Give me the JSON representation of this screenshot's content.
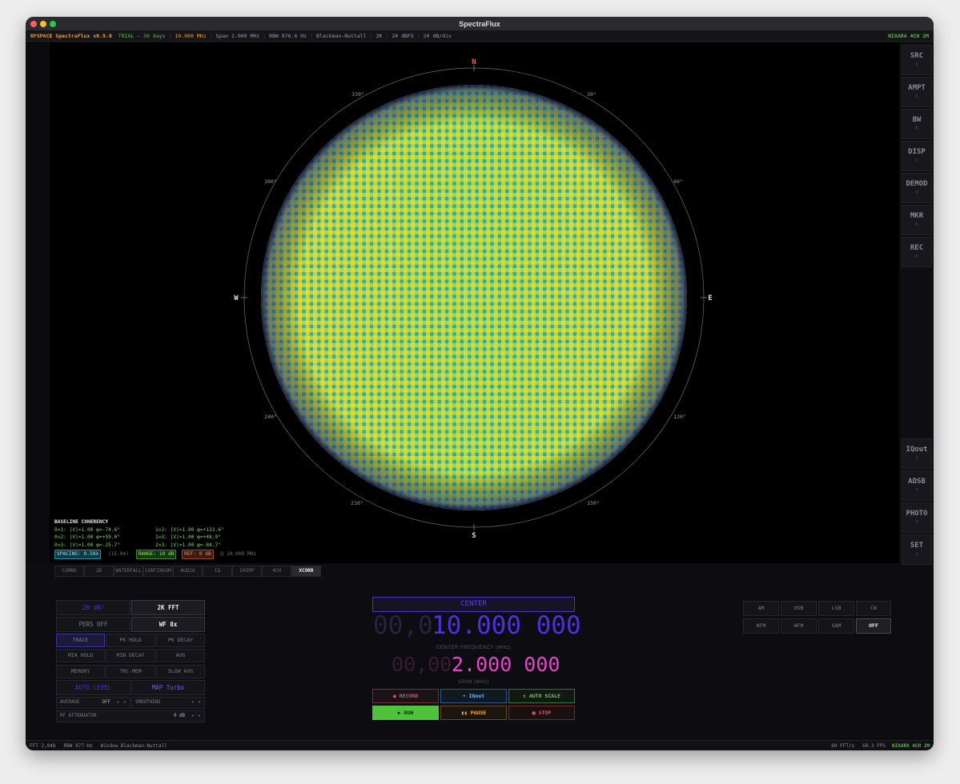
{
  "window": {
    "title": "SpectraFlux"
  },
  "status": {
    "brand": "RFSPACE SpectraFlux v0.9.0",
    "trial": "TRIAL — 30 days",
    "freq": "10.000 MHz",
    "span": "Span 2.000 MHz",
    "rbw": "RBW 976.6 Hz",
    "window": "Blackman-Nuttall",
    "fft": "2K",
    "ref": "20 dBFS",
    "scale": "20 dB/div",
    "device": "NIXARA 4CH 2M"
  },
  "compass": {
    "n": "N",
    "e": "E",
    "s": "S",
    "w": "W",
    "d30": "30°",
    "d60": "60°",
    "d120": "120°",
    "d150": "150°",
    "d210": "210°",
    "d240": "240°",
    "d300": "300°",
    "d330": "330°"
  },
  "coherency": {
    "title": "BASELINE COHERENCY",
    "rows": [
      "0×1: |V|=1.00  φ=-74.6°",
      "0×2: |V|=1.00  φ=+59.0°",
      "0×3: |V|=1.00  φ=-25.7°"
    ],
    "rows2": [
      "1×2: |V|=1.00  φ=+133.6°",
      "1×3: |V|=1.00  φ=+48.9°",
      "2×3: |V|=1.00  φ=-84.7°"
    ],
    "spacing": "SPACING: 0.50λ",
    "spacing_m": "(15.0m)",
    "range": "RANGE: 10 dB",
    "ref": "REF: 0 dB",
    "at": "@ 10.000 MHz"
  },
  "rightbar": [
    {
      "label": "SRC",
      "key": "S"
    },
    {
      "label": "AMPT",
      "key": "A"
    },
    {
      "label": "BW",
      "key": "B"
    },
    {
      "label": "DISP",
      "key": "D"
    },
    {
      "label": "DEMOD",
      "key": "M"
    },
    {
      "label": "MKR",
      "key": "K"
    },
    {
      "label": "REC",
      "key": "R"
    },
    {
      "label": "IQout",
      "key": "I"
    },
    {
      "label": "ADSB",
      "key": "T"
    },
    {
      "label": "PHOTO",
      "key": "P"
    },
    {
      "label": "SET",
      "key": "G"
    }
  ],
  "tabs": [
    "COMBO",
    "2D",
    "WATERFALL",
    "CONTINUUM",
    "AUDIO",
    "IQ",
    "CHIRP",
    "4CH",
    "XCORR"
  ],
  "left_controls": {
    "db_div": "20 dB/",
    "fft": "2K FFT",
    "pers": "PERS OFF",
    "wf": "WF 8x",
    "trace": "TRACE",
    "pk_hold": "PK HOLD",
    "pk_decay": "PK DECAY",
    "min_hold": "MIN HOLD",
    "min_decay": "MIN DECAY",
    "avg": "AVG",
    "memory": "MEMORY",
    "trc_mem": "TRC-MEM",
    "slow_avg": "SLOW AVG",
    "auto_level": "AUTO LEVEL",
    "map": "MAP Turbo",
    "average_label": "AVERAGE",
    "average_val": "OFF",
    "smoothing_label": "SMOOTHING",
    "rf_att_label": "RF ATTENUATOR",
    "rf_att_val": "0 dB"
  },
  "center": {
    "title": "CENTER",
    "freq_dim": "00,0",
    "freq": "10.000 000",
    "freq_label": "CENTER FREQUENCY (MHz)",
    "span_dim": "00,00",
    "span": "2.000 000",
    "span_label": "SPAN (MHz)",
    "record": "● RECORD",
    "iqout": "➔ IQout",
    "autoscale": "↕ AUTO SCALE",
    "run": "▶ RUN",
    "pause": "▮▮ PAUSE",
    "stop": "■ STOP"
  },
  "demod": [
    "AM",
    "USB",
    "LSB",
    "CW",
    "NFM",
    "WFM",
    "SAM",
    "OFF"
  ],
  "bottom": {
    "fft": "FFT 2,048",
    "rbw": "RBW 977 Hz",
    "window": "Window Blackman-Nuttall",
    "fps1": "60 FFT/s",
    "fps2": "60.3 FPS",
    "device": "NIXARA 4CH 2M"
  },
  "colors": {
    "accent": "#3b1fd6",
    "magenta": "#e545c8",
    "green": "#4ec23a",
    "red": "#d94b45"
  }
}
